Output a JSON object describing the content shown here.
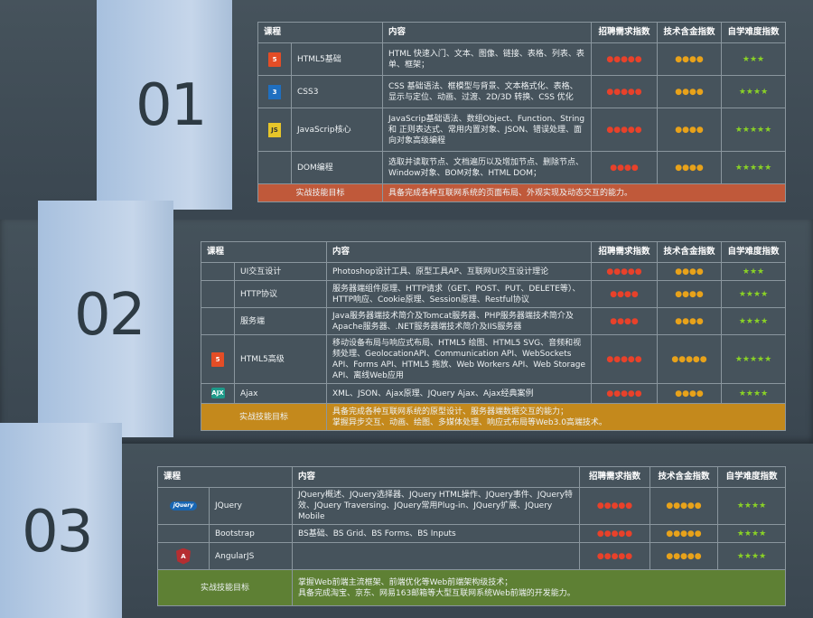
{
  "headers": {
    "course": "课程",
    "content": "内容",
    "demand": "招聘需求指数",
    "tech": "技术含金指数",
    "self": "自学难度指数"
  },
  "sections": [
    {
      "num": "01",
      "rows": [
        {
          "icon": "html5-icon",
          "name": "HTML5基础",
          "content": "HTML 快速入门、文本、图像、链接、表格、列表、表单、框架；",
          "d": "●●●●●",
          "t": "●●●●",
          "s": "★★★"
        },
        {
          "icon": "css3-icon",
          "name": "CSS3",
          "content": "CSS 基础语法、框模型与背景、文本格式化、表格、显示与定位、动画、过渡、2D/3D 转换、CSS 优化",
          "d": "●●●●●",
          "t": "●●●●",
          "s": "★★★★"
        },
        {
          "icon": "js-icon",
          "name": "JavaScrip核心",
          "content": "JavaScrip基础语法、数组Object、Function、String 和 正则表达式、常用内置对象、JSON、错误处理、面向对象高级编程",
          "d": "●●●●●",
          "t": "●●●●",
          "s": "★★★★★"
        },
        {
          "icon": "",
          "name": "DOM编程",
          "content": "选取并读取节点、文档遍历以及增加节点、删除节点、Window对象、BOM对象、HTML DOM；",
          "d": "●●●●",
          "t": "●●●●",
          "s": "★★★★★"
        }
      ],
      "goal_label": "实战技能目标",
      "goal": "具备完成各种互联网系统的页面布局、外观实现及动态交互的能力。"
    },
    {
      "num": "02",
      "rows": [
        {
          "icon": "",
          "name": "UI交互设计",
          "content": "Photoshop设计工具、原型工具AP、互联网UI交互设计理论",
          "d": "●●●●●",
          "t": "●●●●",
          "s": "★★★"
        },
        {
          "icon": "",
          "name": "HTTP协议",
          "content": "服务器端组件原理、HTTP请求（GET、POST、PUT、DELETE等）、HTTP响应、Cookie原理、Session原理、Restful协议",
          "d": "●●●●",
          "t": "●●●●",
          "s": "★★★★"
        },
        {
          "icon": "",
          "name": "服务端",
          "content": "Java服务器端技术简介及Tomcat服务器、PHP服务器端技术简介及Apache服务器、.NET服务器端技术简介及IIS服务器",
          "d": "●●●●",
          "t": "●●●●",
          "s": "★★★★"
        },
        {
          "icon": "html5-icon",
          "name": "HTML5高级",
          "content": "移动设备布局与响应式布局、HTML5 绘图、HTML5 SVG、音频和视频处理、GeolocationAPI、Communication API、WebSockets API、Forms API、HTML5 拖放、Web Workers API、Web Storage API、离线Web应用",
          "d": "●●●●●",
          "t": "●●●●●",
          "s": "★★★★★"
        },
        {
          "icon": "ajax-icon",
          "name": "Ajax",
          "content": "XML、JSON、Ajax原理、JQuery Ajax、Ajax经典案例",
          "d": "●●●●●",
          "t": "●●●●",
          "s": "★★★★"
        }
      ],
      "goal_label": "实战技能目标",
      "goal": "具备完成各种互联网系统的原型设计、服务器端数据交互的能力；\n掌握异步交互、动画、绘图、多媒体处理、响应式布局等Web3.0高端技术。"
    },
    {
      "num": "03",
      "rows": [
        {
          "icon": "jquery-icon",
          "name": "JQuery",
          "content": "JQuery概述、JQuery选择器、JQuery HTML操作、JQuery事件、JQuery特效、JQuery Traversing、JQuery常用Plug-in、JQuery扩展、JQuery Mobile",
          "d": "●●●●●",
          "t": "●●●●●",
          "s": "★★★★"
        },
        {
          "icon": "",
          "name": "Bootstrap",
          "content": "BS基础、BS Grid、BS Forms、BS Inputs",
          "d": "●●●●●",
          "t": "●●●●●",
          "s": "★★★★"
        },
        {
          "icon": "angular-icon",
          "name": "AngularJS",
          "content": "",
          "d": "●●●●●",
          "t": "●●●●●",
          "s": "★★★★"
        }
      ],
      "goal_label": "实战技能目标",
      "goal": "掌握Web前端主流框架、前端优化等Web前端架构级技术；\n具备完成淘宝、京东、网易163邮箱等大型互联网系统Web前端的开发能力。"
    }
  ]
}
